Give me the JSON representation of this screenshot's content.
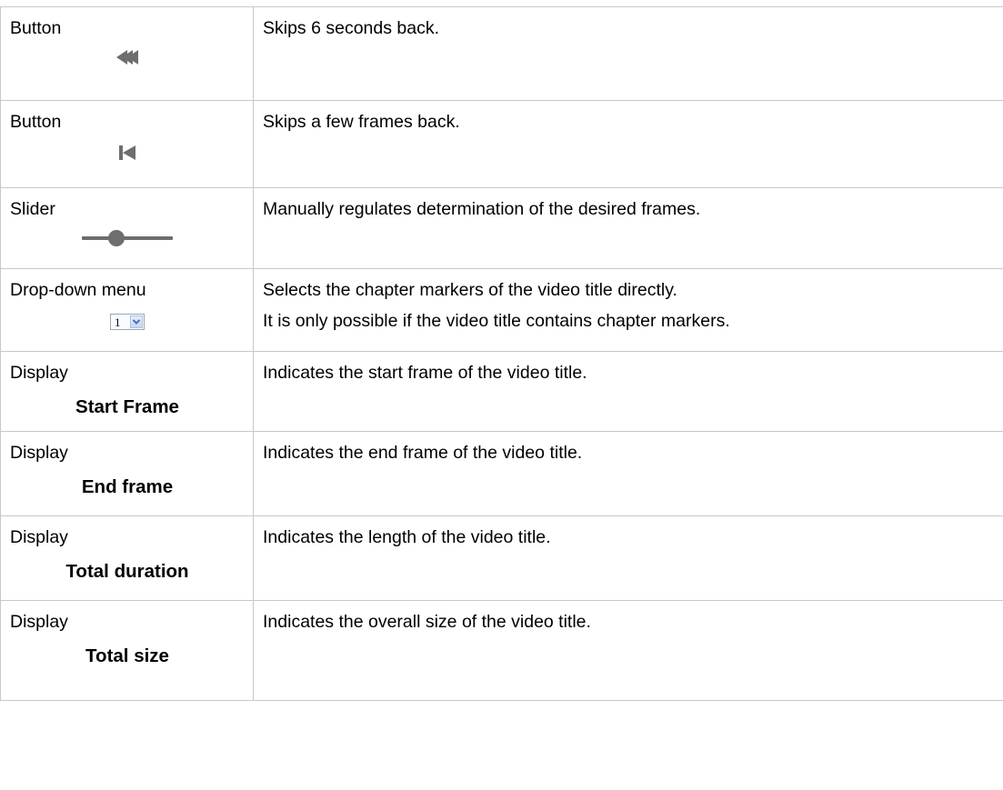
{
  "rows": [
    {
      "label": "Button",
      "icon": "rewind-double-arrow-icon",
      "description": [
        "Skips 6 seconds back."
      ]
    },
    {
      "label": "Button",
      "icon": "skip-back-frame-icon",
      "description": [
        "Skips a few frames back."
      ]
    },
    {
      "label": "Slider",
      "icon": "slider-icon",
      "description": [
        "Manually regulates determination of the desired frames."
      ]
    },
    {
      "label": "Drop-down menu",
      "icon": "dropdown-select",
      "dropdown_value": "1",
      "description": [
        "Selects the chapter markers of the video title directly.",
        "It is only possible if the video title contains chapter markers."
      ]
    },
    {
      "label": "Display",
      "sublabel": "Start Frame",
      "description": [
        "Indicates the start frame of the video title."
      ]
    },
    {
      "label": "Display",
      "sublabel": "End frame",
      "description": [
        "Indicates the end frame of the video title."
      ]
    },
    {
      "label": "Display",
      "sublabel": "Total duration",
      "description": [
        "Indicates the length of the video title."
      ]
    },
    {
      "label": "Display",
      "sublabel": "Total size",
      "description": [
        "Indicates the overall size of the video title."
      ]
    }
  ],
  "colors": {
    "border": "#c8c8c8",
    "icon_gray": "#6e6e6e",
    "select_border": "#9aa7b8",
    "select_arrow": "#4a6fb5"
  }
}
